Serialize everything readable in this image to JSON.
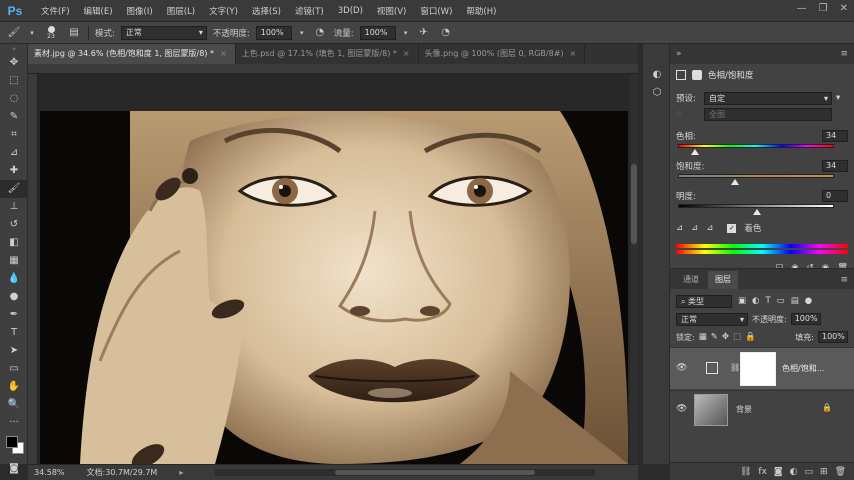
{
  "app": {
    "logo": "Ps"
  },
  "menu": [
    "文件(F)",
    "编辑(E)",
    "图像(I)",
    "图层(L)",
    "文字(Y)",
    "选择(S)",
    "滤镜(T)",
    "3D(D)",
    "视图(V)",
    "窗口(W)",
    "帮助(H)"
  ],
  "options": {
    "brush_size": "23",
    "mode_label": "模式:",
    "mode_value": "正常",
    "opacity_label": "不透明度:",
    "opacity_value": "100%",
    "flow_label": "流量:",
    "flow_value": "100%"
  },
  "tabs": [
    {
      "label": "素材.jpg @ 34.6% (色相/饱和度 1, 图层蒙版/8) *",
      "active": true
    },
    {
      "label": "上色.psd @ 17.1% (填色 1, 图层蒙版/8) *",
      "active": false
    },
    {
      "label": "头像.png @ 100% (图层 0, RGB/8#)",
      "active": false
    }
  ],
  "status": {
    "zoom": "34.58%",
    "doc": "文档:30.7M/29.7M"
  },
  "properties": {
    "panel_title": "属性",
    "adjustment_name": "色相/饱和度",
    "preset_label": "预设:",
    "preset_value": "自定",
    "channel_value": "全图",
    "hue_label": "色相:",
    "hue_value": "34",
    "saturation_label": "饱和度:",
    "saturation_value": "34",
    "lightness_label": "明度:",
    "lightness_value": "0",
    "colorize_label": "着色",
    "colorize_checked": true,
    "hue_fraction": 0.1,
    "saturation_fraction": 0.36,
    "lightness_fraction": 0.5
  },
  "layers_panel": {
    "tabs": [
      "通道",
      "图层"
    ],
    "filter_value": "类型",
    "blend_value": "正常",
    "opacity_label": "不透明度:",
    "opacity_value": "100%",
    "lock_label": "锁定:",
    "fill_label": "填充:",
    "fill_value": "100%",
    "layers": [
      {
        "name": "色相/饱和...",
        "type": "adjustment"
      },
      {
        "name": "背景",
        "type": "background"
      }
    ]
  },
  "colors": {
    "sepia_light": "#e8d6bd",
    "sepia_mid": "#b89a74",
    "sepia_dark": "#4a3726",
    "ui_bg": "#3a3a3a"
  }
}
